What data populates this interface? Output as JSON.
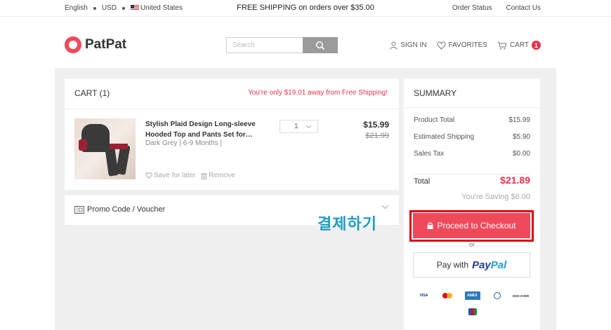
{
  "topbar": {
    "language": "English",
    "currency": "USD",
    "country": "United States",
    "promo": "FREE SHIPPING on orders over $35.00",
    "order_status": "Order Status",
    "contact_us": "Contact Us"
  },
  "header": {
    "logo": "PatPat",
    "search_placeholder": "Search",
    "sign_in": "SIGN IN",
    "favorites": "FAVORITES",
    "cart": "CART",
    "cart_count": "1"
  },
  "cart": {
    "title": "CART (1)",
    "free_shipping_note": "You're only $19.01 away from Free Shipping!",
    "item": {
      "name": "Stylish Plaid Design Long-sleeve Hooded Top and Pants Set for…",
      "variant": "Dark Grey | 6-9 Months |",
      "quantity": "1",
      "price": "$15.99",
      "original_price": "$21.99",
      "save_for_later": "Save for later",
      "remove": "Remove"
    },
    "promo_label": "Promo Code / Voucher"
  },
  "annotation": "결제하기",
  "summary": {
    "title": "SUMMARY",
    "rows": [
      {
        "label": "Product Total",
        "value": "$15.99"
      },
      {
        "label": "Estimated Shipping",
        "value": "$5.90"
      },
      {
        "label": "Sales Tax",
        "value": "$0.00"
      }
    ],
    "total_label": "Total",
    "total_value": "$21.89",
    "saving": "You're Saving $6.00",
    "checkout": "Proceed to Checkout",
    "or": "or",
    "pay_with": "Pay with",
    "paypal_a": "Pay",
    "paypal_b": "Pal",
    "cards": {
      "visa": "VISA",
      "amex": "AMEX",
      "discover": "DISCOVER"
    }
  },
  "colors": {
    "brand": "#f04a5c",
    "checkout_outline": "#e00010",
    "annotation": "#1d9dc3"
  }
}
